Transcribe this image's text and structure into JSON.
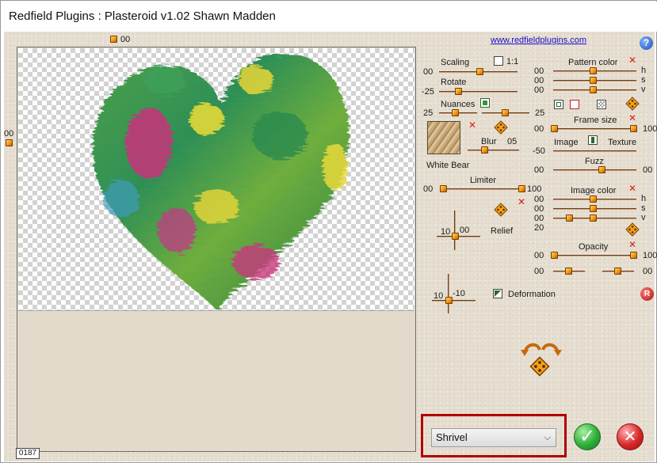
{
  "window": {
    "title": "Redfield Plugins : Plasteroid v1.02   Shawn Madden",
    "link": "www.redfieldplugins.com",
    "help_glyph": "?"
  },
  "preview": {
    "top_value": "00",
    "left_value": "00",
    "counter": "0187"
  },
  "colors": {
    "accent_knob": "#f29a12",
    "track": "#6b3a1c",
    "close_red": "#d91c1c",
    "ok_green": "#2fae3a",
    "cancel_red": "#d82828",
    "highlight_frame": "#b00000"
  },
  "left_panel": {
    "scaling": {
      "label": "Scaling",
      "value": "00",
      "one_to_one": "1:1"
    },
    "rotate": {
      "label": "Rotate",
      "value": "-25"
    },
    "nuances": {
      "label": "Nuances",
      "left_value": "25",
      "right_value": "25"
    },
    "texture": {
      "name": "White Bear",
      "blur_label": "Blur",
      "blur_value": "05"
    },
    "limiter": {
      "label": "Limiter",
      "min": "00",
      "max": "100"
    },
    "relief": {
      "label": "Relief",
      "h_value": "10",
      "v_value": "00"
    },
    "deformation": {
      "label": "Deformation",
      "h_value": "10",
      "v_value": "-10"
    }
  },
  "right_panel": {
    "pattern_color": {
      "label": "Pattern color",
      "h": "00",
      "s": "00",
      "v": "00",
      "h_label": "h",
      "s_label": "s",
      "v_label": "v"
    },
    "frame_size": {
      "label": "Frame size",
      "min": "00",
      "max": "100"
    },
    "image_texture": {
      "image_label": "Image",
      "texture_label": "Texture",
      "value": "-50"
    },
    "fuzz": {
      "label": "Fuzz",
      "min": "00",
      "max": "00"
    },
    "image_color": {
      "label": "Image color",
      "h": "00",
      "s": "00",
      "v": "00",
      "extra": "20",
      "h_label": "h",
      "s_label": "s",
      "v_label": "v"
    },
    "opacity": {
      "label": "Opacity",
      "min": "00",
      "max": "100",
      "low_left": "00",
      "low_right": "00"
    },
    "reset_glyph": "R"
  },
  "preset": {
    "selected": "Shrivel"
  },
  "icons": {
    "close_x": "✕",
    "check": "✓",
    "chevron": "⌵"
  }
}
